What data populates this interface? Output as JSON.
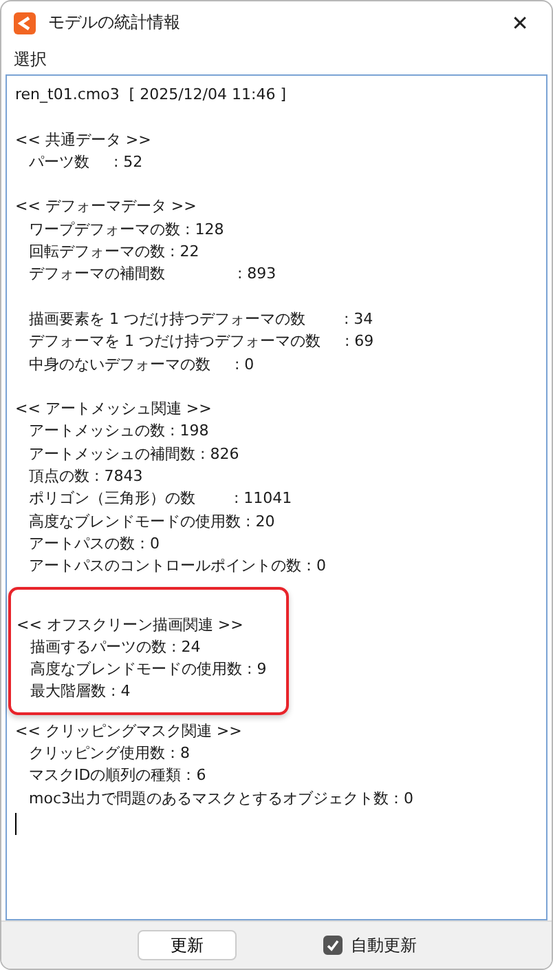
{
  "window": {
    "title": "モデルの統計情報",
    "close": "✕"
  },
  "menu": [
    "選択"
  ],
  "report": {
    "header": "ren_t01.cmo3  [ 2025/12/04 11:46 ]",
    "sections": [
      {
        "title": "<< 共通データ >>",
        "highlighted": false,
        "groups": [
          [
            "パーツ数     : 52"
          ]
        ]
      },
      {
        "title": "<< デフォーマデータ >>",
        "highlighted": false,
        "groups": [
          [
            "ワープデフォーマの数 : 128",
            "回転デフォーマの数 : 22",
            "デフォーマの補間数               : 893"
          ],
          [
            "描画要素を 1 つだけ持つデフォーマの数        : 34",
            "デフォーマを 1 つだけ持つデフォーマの数     : 69",
            "中身のないデフォーマの数     : 0"
          ]
        ]
      },
      {
        "title": "<< アートメッシュ関連 >>",
        "highlighted": false,
        "groups": [
          [
            "アートメッシュの数 : 198",
            "アートメッシュの補間数 : 826",
            "頂点の数 : 7843",
            "ポリゴン（三角形）の数        : 11041",
            "高度なブレンドモードの使用数 : 20",
            "アートパスの数：0",
            "アートパスのコントロールポイントの数：0"
          ]
        ]
      },
      {
        "title": "<< オフスクリーン描画関連 >>",
        "highlighted": true,
        "groups": [
          [
            "描画するパーツの数 : 24",
            "高度なブレンドモードの使用数 : 9",
            "最大階層数 : 4"
          ]
        ]
      },
      {
        "title": "<< クリッピングマスク関連 >>",
        "highlighted": false,
        "groups": [
          [
            "クリッピング使用数：8",
            "マスクIDの順列の種類：6",
            "moc3出力で問題のあるマスクとするオブジェクト数：0"
          ]
        ]
      }
    ]
  },
  "footer": {
    "button": "更新",
    "auto_update": {
      "label": "自動更新",
      "checked": true
    }
  }
}
